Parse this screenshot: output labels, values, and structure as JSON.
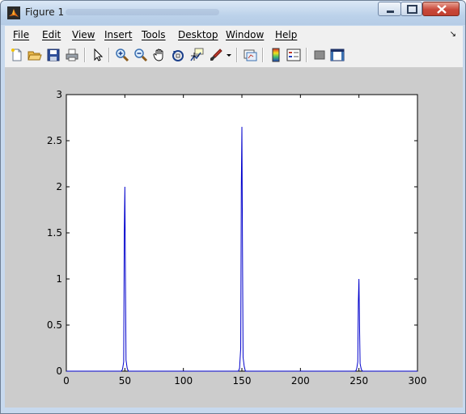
{
  "window": {
    "title": "Figure 1",
    "accent": "#c7d9ee",
    "close_color": "#c9483a"
  },
  "menubar": {
    "items": [
      "File",
      "Edit",
      "View",
      "Insert",
      "Tools",
      "Desktop",
      "Window",
      "Help"
    ]
  },
  "toolbar": {
    "buttons": [
      "new-figure-icon",
      "open-file-icon",
      "save-icon",
      "print-icon",
      "edit-plot-arrow-icon",
      "zoom-in-icon",
      "zoom-out-icon",
      "pan-hand-icon",
      "rotate-3d-icon",
      "data-cursor-icon",
      "brush-icon",
      "brush-dropdown-icon",
      "link-plot-icon",
      "insert-colorbar-icon",
      "insert-legend-icon",
      "hide-plot-tools-icon",
      "show-plot-tools-icon"
    ]
  },
  "chart_data": {
    "type": "line",
    "title": "",
    "xlabel": "",
    "ylabel": "",
    "xlim": [
      0,
      300
    ],
    "ylim": [
      0,
      3
    ],
    "xticks": [
      0,
      50,
      100,
      150,
      200,
      250,
      300
    ],
    "yticks": [
      0,
      0.5,
      1,
      1.5,
      2,
      2.5,
      3
    ],
    "xtick_labels": [
      "0",
      "50",
      "100",
      "150",
      "200",
      "250",
      "300"
    ],
    "ytick_labels": [
      "0",
      "0.5",
      "1",
      "1.5",
      "2",
      "2.5",
      "3"
    ],
    "grid": false,
    "line_color": "#0000cc",
    "series": [
      {
        "x": [
          0,
          47,
          48,
          49,
          49.5,
          50,
          50.5,
          51,
          52,
          53,
          147,
          148,
          149,
          149.5,
          150,
          150.5,
          151,
          152,
          153,
          247,
          248,
          249,
          249.5,
          250,
          250.5,
          251,
          252,
          253,
          300
        ],
        "y": [
          0,
          0,
          0.02,
          0.1,
          1.5,
          2.0,
          1.0,
          0.12,
          0.03,
          0,
          0,
          0.03,
          0.25,
          2.0,
          2.65,
          1.35,
          0.15,
          0.05,
          0,
          0,
          0.02,
          0.1,
          0.75,
          1.0,
          0.5,
          0.08,
          0.02,
          0,
          0
        ]
      }
    ]
  }
}
